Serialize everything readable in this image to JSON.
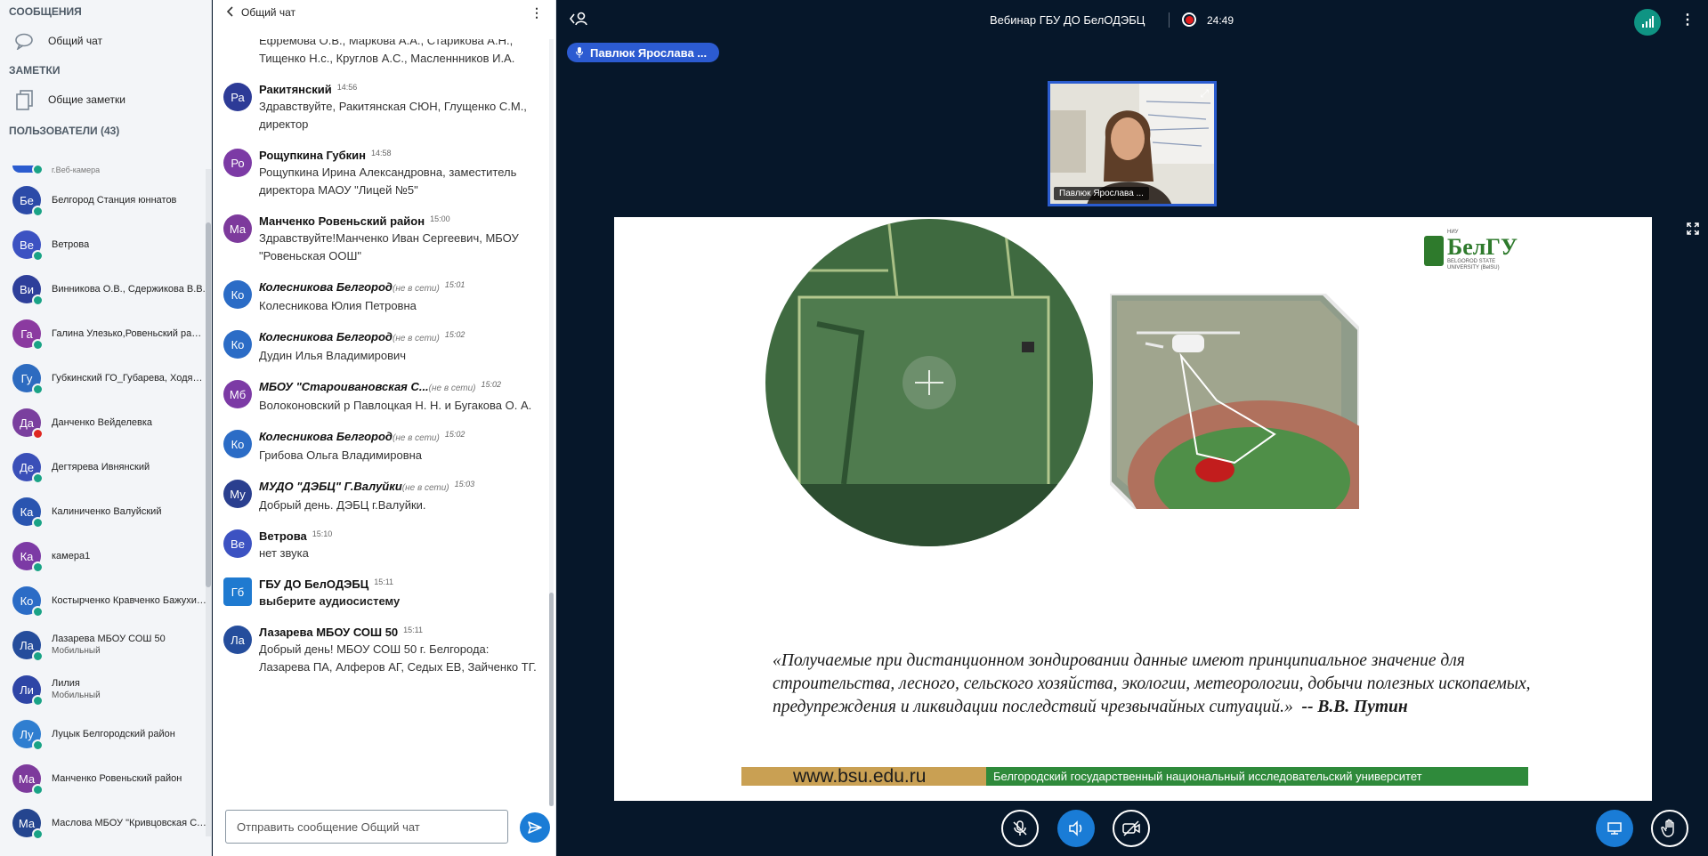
{
  "sidebar": {
    "messages_title": "СООБЩЕНИЯ",
    "public_chat_label": "Общий чат",
    "notes_title": "ЗАМЕТКИ",
    "shared_notes_label": "Общие заметки",
    "users_title": "ПОЛЬЗОВАТЕЛИ (43)",
    "users": [
      {
        "initials": "",
        "name": "г.Веб-камера",
        "color": "#2b5ccf",
        "status": "green",
        "sub": ""
      },
      {
        "initials": "Бе",
        "name": "Белгород Станция юннатов",
        "color": "#2b4aa8",
        "status": "green",
        "sub": ""
      },
      {
        "initials": "Ве",
        "name": "Ветрова",
        "color": "#3c52c2",
        "status": "green",
        "sub": ""
      },
      {
        "initials": "Ви",
        "name": "Винникова О.В., Сдержикова В.В.",
        "color": "#2e3f9a",
        "status": "green",
        "sub": ""
      },
      {
        "initials": "Га",
        "name": "Галина Улезько,Ровеньский район",
        "color": "#8b3aa0",
        "status": "green",
        "sub": ""
      },
      {
        "initials": "Гу",
        "name": "Губкинский ГО_Губарева, Ходякова",
        "color": "#2d6bc0",
        "status": "green",
        "sub": ""
      },
      {
        "initials": "Да",
        "name": "Данченко Вейделевка",
        "color": "#7a3f9e",
        "status": "red",
        "sub": ""
      },
      {
        "initials": "Де",
        "name": "Дегтярева Ивнянский",
        "color": "#3a4fb8",
        "status": "green",
        "sub": ""
      },
      {
        "initials": "Ка",
        "name": "Калиниченко Валуйский",
        "color": "#2a55b0",
        "status": "green",
        "sub": ""
      },
      {
        "initials": "Ка",
        "name": "камера1",
        "color": "#7c3aa5",
        "status": "green",
        "sub": ""
      },
      {
        "initials": "Ко",
        "name": "Костырченко Кравченко Бажухина",
        "color": "#2b6cc6",
        "status": "green",
        "sub": ""
      },
      {
        "initials": "Ла",
        "name": "Лазарева МБОУ СОШ 50",
        "color": "#254d9c",
        "status": "green",
        "sub": "Мобильный"
      },
      {
        "initials": "Ли",
        "name": "Лилия",
        "color": "#2e45a6",
        "status": "green",
        "sub": "Мобильный"
      },
      {
        "initials": "Лу",
        "name": "Луцык Белгородский район",
        "color": "#2f7ed0",
        "status": "green",
        "sub": ""
      },
      {
        "initials": "Ма",
        "name": "Манченко Ровеньский район",
        "color": "#7d3a9c",
        "status": "green",
        "sub": ""
      },
      {
        "initials": "Ма",
        "name": "Маслова МБОУ \"Кривцовская СОШ\"",
        "color": "#24458f",
        "status": "green",
        "sub": ""
      }
    ]
  },
  "chat": {
    "title": "Общий чат",
    "messages": [
      {
        "initials": "",
        "color": "#fff",
        "sender": "",
        "offline": "",
        "time": "",
        "italic": false,
        "bold_text": false,
        "text": "Ефремова О.В., Маркова А.А., Старикова А.Н., Тищенко Н.с., Круглов А.С., Масленнников И.А."
      },
      {
        "initials": "Ра",
        "color": "#2d3b97",
        "sender": "Ракитянский",
        "offline": "",
        "time": "14:56",
        "italic": false,
        "bold_text": false,
        "text": "Здравствуйте, Ракитянская СЮН, Глущенко С.М., директор"
      },
      {
        "initials": "Ро",
        "color": "#7c3aa5",
        "sender": "Рощупкина Губкин",
        "offline": "",
        "time": "14:58",
        "italic": false,
        "bold_text": false,
        "text": "Рощупкина Ирина Александровна, заместитель директора МАОУ \"Лицей №5\""
      },
      {
        "initials": "Ма",
        "color": "#7d3a9c",
        "sender": "Манченко Ровеньский район",
        "offline": "",
        "time": "15:00",
        "italic": false,
        "bold_text": false,
        "text": "Здравствуйте!Манченко Иван Сергеевич, МБОУ \"Ровеньская ООШ\""
      },
      {
        "initials": "Ко",
        "color": "#2b6cc6",
        "sender": "Колесникова Белгород",
        "offline": "(не в сети)",
        "time": "15:01",
        "italic": true,
        "bold_text": false,
        "text": "Колесникова Юлия Петровна"
      },
      {
        "initials": "Ко",
        "color": "#2b6cc6",
        "sender": "Колесникова Белгород",
        "offline": "(не в сети)",
        "time": "15:02",
        "italic": true,
        "bold_text": false,
        "text": "Дудин Илья Владимирович"
      },
      {
        "initials": "Мб",
        "color": "#7c3aa5",
        "sender": "МБОУ \"Староивановская С...",
        "offline": "(не в сети)",
        "time": "15:02",
        "italic": true,
        "bold_text": false,
        "text": "Волоконовский р Павлоцкая Н. Н. и Бугакова О. А."
      },
      {
        "initials": "Ко",
        "color": "#2b6cc6",
        "sender": "Колесникова Белгород",
        "offline": "(не в сети)",
        "time": "15:02",
        "italic": true,
        "bold_text": false,
        "text": "Грибова Ольга Владимировна"
      },
      {
        "initials": "Му",
        "color": "#2a3f8f",
        "sender": "МУДО \"ДЭБЦ\" Г.Валуйки",
        "offline": "(не в сети)",
        "time": "15:03",
        "italic": true,
        "bold_text": false,
        "text": "Добрый день. ДЭБЦ г.Валуйки."
      },
      {
        "initials": "Ве",
        "color": "#3c52c2",
        "sender": "Ветрова",
        "offline": "",
        "time": "15:10",
        "italic": false,
        "bold_text": false,
        "text": "нет звука"
      },
      {
        "initials": "Гб",
        "color": "#1f7ad0",
        "sender": "ГБУ ДО БелОДЭБЦ",
        "offline": "",
        "time": "15:11",
        "italic": false,
        "bold_text": true,
        "square": true,
        "text": "выберите аудиосистему"
      },
      {
        "initials": "Ла",
        "color": "#254d9c",
        "sender": "Лазарева МБОУ СОШ 50",
        "offline": "",
        "time": "15:11",
        "italic": false,
        "bold_text": false,
        "text": "Добрый день! МБОУ СОШ 50 г. Белгорода: Лазарева ПА, Алферов АГ, Седых ЕВ, Зайченко ТГ."
      }
    ],
    "input_placeholder": "Отправить сообщение Общий чат"
  },
  "topbar": {
    "meeting_title": "Вебинар ГБУ ДО БелОДЭБЦ",
    "recording_time": "24:49"
  },
  "talking_indicator": "Павлюк Ярослава ...",
  "webcam": {
    "label": "Павлюк Ярослава ..."
  },
  "slide": {
    "logo_brand": "БелГУ",
    "logo_small_1": "НИУ",
    "logo_small_2": "BELGOROD STATE",
    "logo_small_3": "UNIVERSITY (BelSU)",
    "quote": "«Получаемые при дистанционном зондировании данные имеют принципиальное значение для строительства, лесного, сельского хозяйства, экологии, метеорологии, добычи полезных ископаемых, предупреждения и ликвидации последствий чрезвычайных ситуаций.»",
    "author": "-- В.В. Путин",
    "url": "www.bsu.edu.ru",
    "university": "Белгородский государственный национальный исследовательский университет"
  },
  "colors": {
    "accent": "#1a7cd6",
    "background": "#06172a",
    "online": "#1aa386",
    "offline": "#df2721",
    "talker": "#2c5bd1"
  }
}
